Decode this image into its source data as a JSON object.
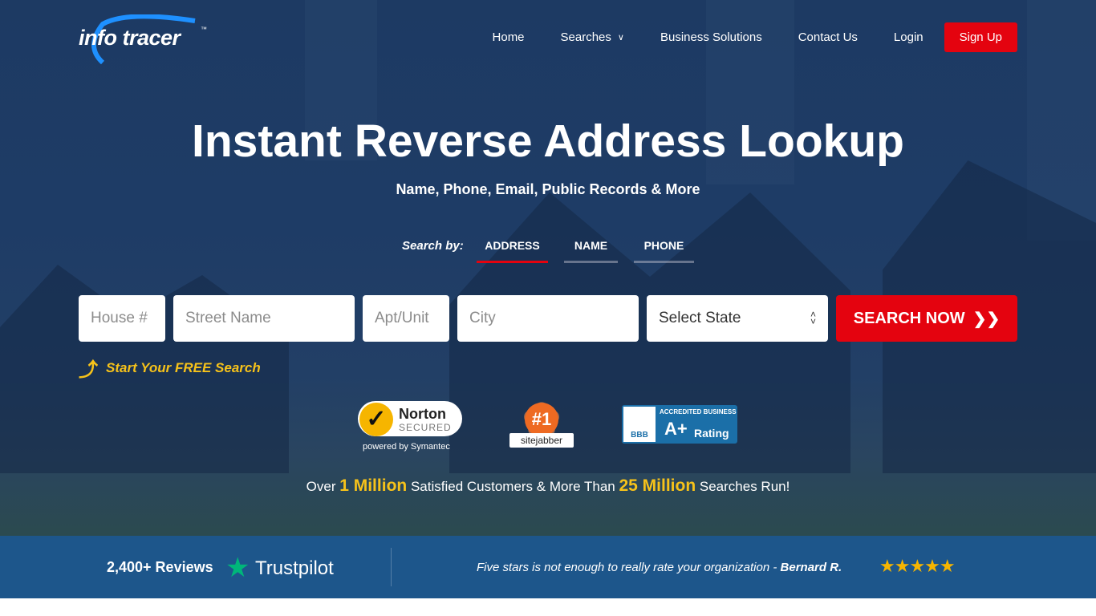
{
  "brand": {
    "logo_text": "info tracer",
    "tm": "™"
  },
  "nav": {
    "items": [
      "Home",
      "Searches",
      "Business Solutions",
      "Contact Us",
      "Login"
    ],
    "signup": "Sign Up"
  },
  "hero": {
    "title": "Instant Reverse Address Lookup",
    "subtitle": "Name, Phone, Email, Public Records & More"
  },
  "search": {
    "by_label": "Search by:",
    "tabs": [
      "ADDRESS",
      "NAME",
      "PHONE"
    ],
    "active_tab": "ADDRESS",
    "fields": {
      "house": "House #",
      "street": "Street Name",
      "apt": "Apt/Unit",
      "city": "City"
    },
    "state": "Select State",
    "button": "SEARCH NOW",
    "free": "Start Your FREE Search"
  },
  "badges": {
    "norton": {
      "name": "Norton",
      "secured": "SECURED",
      "powered": "powered by Symantec"
    },
    "sitejabber": {
      "rank": "#1",
      "name": "sitejabber"
    },
    "bbb": {
      "top": "ACCREDITED BUSINESS",
      "grade": "A+",
      "rating": "Rating",
      "logo": "BBB"
    }
  },
  "stats": {
    "pre": "Over ",
    "customers": "1 Million",
    "mid": " Satisfied Customers & More Than ",
    "searches": "25 Million",
    "post": " Searches Run!"
  },
  "reviews": {
    "count": "2,400+ Reviews",
    "platform": "Trustpilot",
    "quote": "Five stars is not enough to really rate your organization - ",
    "author": "Bernard R.",
    "stars": "★★★★★",
    "rating": 5
  },
  "colors": {
    "accent": "#e4030f",
    "highlight": "#f6c21a",
    "bar": "#1d568b",
    "trustpilot": "#00b67a"
  }
}
